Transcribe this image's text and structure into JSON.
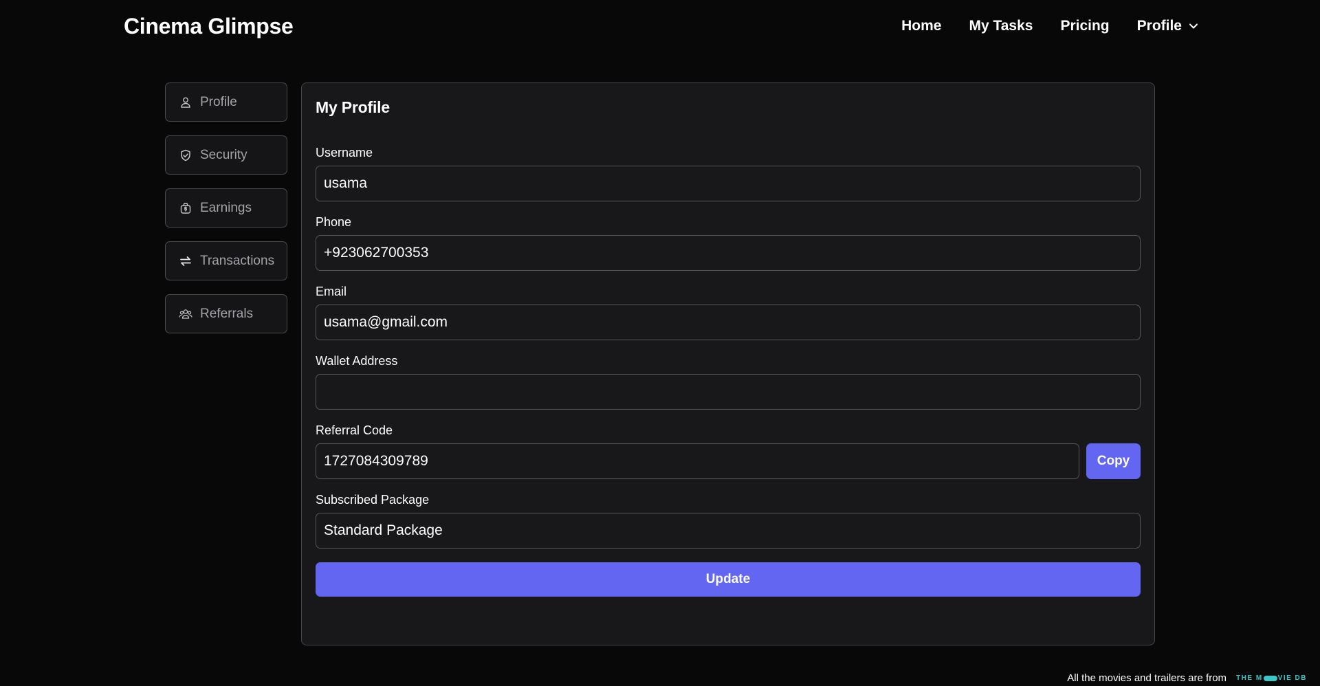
{
  "header": {
    "brand": "Cinema Glimpse",
    "nav": [
      {
        "label": "Home"
      },
      {
        "label": "My Tasks"
      },
      {
        "label": "Pricing"
      },
      {
        "label": "Profile"
      }
    ]
  },
  "sidebar": {
    "items": [
      {
        "label": "Profile",
        "icon": "user-icon"
      },
      {
        "label": "Security",
        "icon": "shield-check-icon"
      },
      {
        "label": "Earnings",
        "icon": "money-bag-icon"
      },
      {
        "label": "Transactions",
        "icon": "arrows-swap-icon"
      },
      {
        "label": "Referrals",
        "icon": "users-icon"
      }
    ]
  },
  "profile": {
    "title": "My Profile",
    "fields": {
      "username": {
        "label": "Username",
        "value": "usama"
      },
      "phone": {
        "label": "Phone",
        "value": "+923062700353"
      },
      "email": {
        "label": "Email",
        "value": "usama@gmail.com"
      },
      "wallet": {
        "label": "Wallet Address",
        "value": ""
      },
      "referral": {
        "label": "Referral Code",
        "value": "1727084309789"
      },
      "package": {
        "label": "Subscribed Package",
        "value": "Standard Package"
      }
    },
    "copy_label": "Copy",
    "update_label": "Update"
  },
  "footer": {
    "text": "All the movies and trailers are from",
    "logo_left": "THE M",
    "logo_right": "VIE DB"
  },
  "colors": {
    "accent": "#6366f1",
    "background": "#080808",
    "card": "#18181b",
    "tmdb": "#39c6c6"
  }
}
